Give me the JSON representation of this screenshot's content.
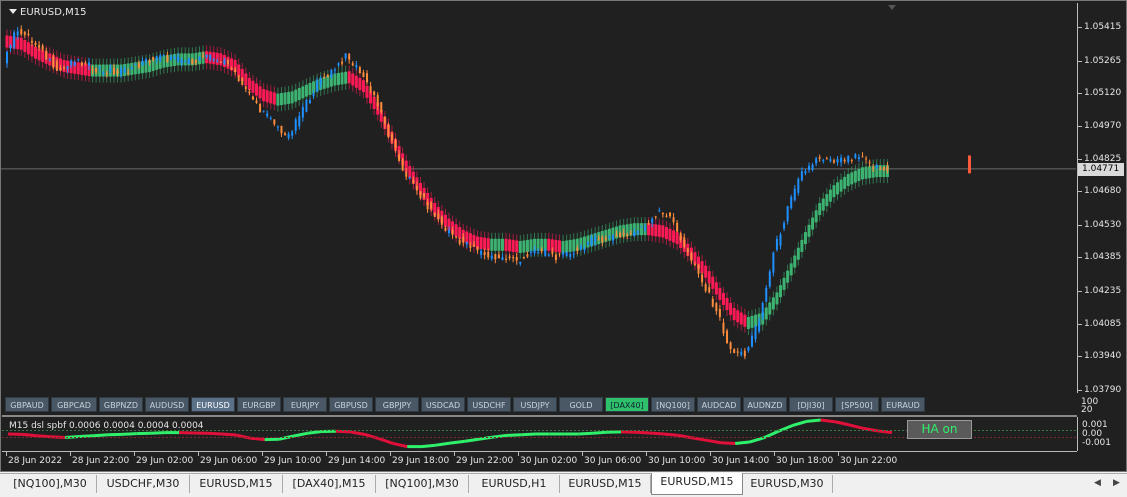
{
  "chart": {
    "title": "EURUSD,M15",
    "price_labels": [
      "1.05415",
      "1.05265",
      "1.05120",
      "1.04970",
      "1.04825",
      "1.04680",
      "1.04530",
      "1.04385",
      "1.04235",
      "1.04085",
      "1.03940",
      "1.03790"
    ],
    "current_price": "1.04771",
    "bull_color": "#1e90ff",
    "bear_color": "#ff8c3c",
    "ha_bear_color": "#ff1a55",
    "ha_bull_color": "#3cb371"
  },
  "symbols": [
    "GBPAUD",
    "GBPCAD",
    "GBPNZD",
    "AUDUSD",
    "EURUSD",
    "EURGBP",
    "EURJPY",
    "GBPUSD",
    "GBPJPY",
    "USDCAD",
    "USDCHF",
    "USDJPY",
    "GOLD",
    "[DAX40]",
    "[NQ100]",
    "AUDCAD",
    "AUDNZD",
    "[DJI30]",
    "[SP500]",
    "EURAUD"
  ],
  "active_symbol": "EURUSD",
  "highlight_symbol": "[DAX40]",
  "indicator": {
    "title": "M15 dsl spbf 0.0006 0.0004 0.0004 0.0004",
    "button_label": "HA on",
    "scale": [
      "0.001",
      "0.00",
      "-0.001"
    ],
    "upper_scale": [
      "100",
      "20"
    ],
    "up_color": "#2ff06a",
    "down_color": "#e0103a"
  },
  "time_labels": [
    "28 Jun 2022",
    "28 Jun 22:00",
    "29 Jun 02:00",
    "29 Jun 06:00",
    "29 Jun 10:00",
    "29 Jun 14:00",
    "29 Jun 18:00",
    "29 Jun 22:00",
    "30 Jun 02:00",
    "30 Jun 06:00",
    "30 Jun 10:00",
    "30 Jun 14:00",
    "30 Jun 18:00",
    "30 Jun 22:00"
  ],
  "tabs": [
    "[NQ100],M30",
    "USDCHF,M30",
    "EURUSD,M15",
    "[DAX40],M15",
    "[NQ100],M30",
    "EURUSD,H1",
    "EURUSD,M15",
    "EURUSD,M15",
    "EURUSD,M30"
  ],
  "active_tab": 7,
  "price_series": [
    1.0527,
    1.0541,
    1.0535,
    1.0528,
    1.0522,
    1.0526,
    1.0524,
    1.0522,
    1.0521,
    1.0523,
    1.0526,
    1.0528,
    1.0527,
    1.0526,
    1.0528,
    1.0527,
    1.0524,
    1.0513,
    1.0505,
    1.0498,
    1.0492,
    1.0505,
    1.0516,
    1.0522,
    1.0528,
    1.0522,
    1.0511,
    1.0493,
    1.0478,
    1.0468,
    1.0459,
    1.0451,
    1.0446,
    1.0442,
    1.0439,
    1.0438,
    1.0437,
    1.044,
    1.0441,
    1.0438,
    1.0441,
    1.0445,
    1.0447,
    1.0448,
    1.0449,
    1.0452,
    1.046,
    1.0454,
    1.044,
    1.0427,
    1.0415,
    1.0396,
    1.0395,
    1.041,
    1.044,
    1.046,
    1.0476,
    1.0482,
    1.0481,
    1.0482,
    1.0483,
    1.0479,
    1.0477
  ],
  "ha_series": [
    1.0535,
    1.0534,
    1.053,
    1.0527,
    1.0524,
    1.0523,
    1.0522,
    1.0522,
    1.0522,
    1.0523,
    1.0524,
    1.0526,
    1.0527,
    1.0527,
    1.0528,
    1.0527,
    1.0524,
    1.0516,
    1.0511,
    1.0509,
    1.051,
    1.0513,
    1.0516,
    1.0518,
    1.0519,
    1.0515,
    1.0505,
    1.0492,
    1.0479,
    1.0469,
    1.046,
    1.0453,
    1.0448,
    1.0445,
    1.0444,
    1.0444,
    1.0443,
    1.0444,
    1.0444,
    1.0443,
    1.0444,
    1.0446,
    1.0448,
    1.045,
    1.0451,
    1.0451,
    1.045,
    1.0447,
    1.044,
    1.0432,
    1.0422,
    1.0413,
    1.0409,
    1.0411,
    1.042,
    1.0433,
    1.0447,
    1.046,
    1.0468,
    1.0473,
    1.0476,
    1.0477,
    1.0477
  ]
}
